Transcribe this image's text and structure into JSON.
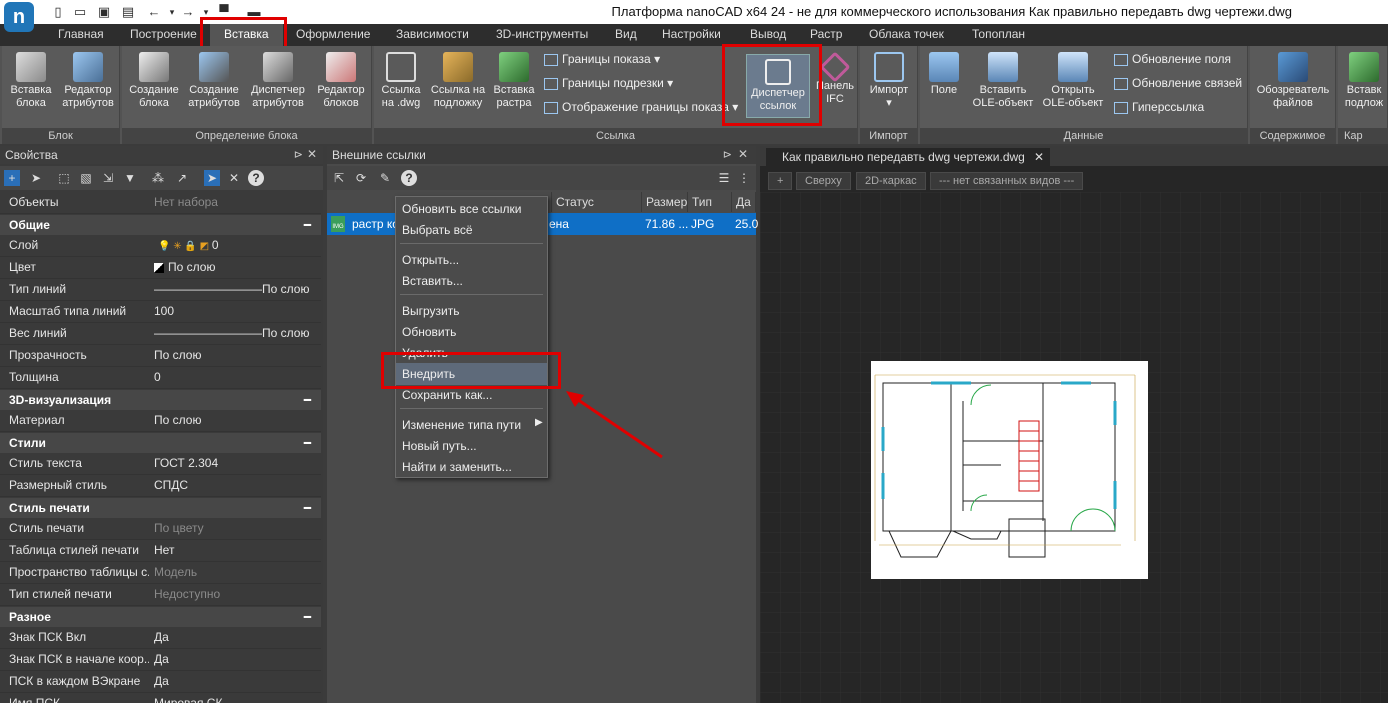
{
  "window": {
    "title": "Платформа nanoCAD x64 24 - не для коммерческого использования Как правильно передавть dwg чертежи.dwg",
    "logo_letter": "n"
  },
  "menu": [
    "Главная",
    "Построение",
    "Вставка",
    "Оформление",
    "Зависимости",
    "3D-инструменты",
    "Вид",
    "Настройки",
    "Вывод",
    "Растр",
    "Облака точек",
    "Топоплан"
  ],
  "ribbon": {
    "block_panel": {
      "label": "Блок",
      "buttons": [
        "Вставка блока",
        "Редактор атрибутов"
      ]
    },
    "block_def_panel": {
      "label": "Определение блока",
      "buttons": [
        "Создание блока",
        "Создание атрибутов",
        "Диспетчер атрибутов",
        "Редактор блоков"
      ]
    },
    "links_panel": {
      "label": "Ссылка",
      "buttons": [
        "Ссылка на .dwg",
        "Ссылка на подложку",
        "Вставка растра"
      ],
      "small": [
        "Границы показа",
        "Границы подрезки",
        "Отображение границы показа"
      ],
      "highlighted": "Диспетчер ссылок",
      "ifc": "Панель IFC"
    },
    "import_panel": {
      "label": "Импорт",
      "button": "Импорт"
    },
    "data_panel": {
      "label": "Данные",
      "buttons": [
        "Поле",
        "Вставить OLE-объект",
        "Открыть OLE-объект"
      ],
      "small": [
        "Обновление поля",
        "Обновление связей",
        "Гиперссылка"
      ]
    },
    "content_panel": {
      "label": "Содержимое",
      "button": "Обозреватель файлов"
    },
    "cut_panel": {
      "label": "Кар",
      "button": "Вставк подлож"
    }
  },
  "properties": {
    "title": "Свойства",
    "objects_label": "Объекты",
    "objects_value": "Нет набора",
    "rows": [
      {
        "type": "section",
        "label": "Общие"
      },
      {
        "type": "row",
        "name": "Слой",
        "value": "0"
      },
      {
        "type": "row",
        "name": "Цвет",
        "value": "По слою"
      },
      {
        "type": "row",
        "name": "Тип линий",
        "value": "—————————По слою"
      },
      {
        "type": "row",
        "name": "Масштаб типа линий",
        "value": "100"
      },
      {
        "type": "row",
        "name": "Вес линий",
        "value": "—————————По слою"
      },
      {
        "type": "row",
        "name": "Прозрачность",
        "value": "По слою"
      },
      {
        "type": "row",
        "name": "Толщина",
        "value": "0"
      },
      {
        "type": "section",
        "label": "3D-визуализация"
      },
      {
        "type": "row",
        "name": "Материал",
        "value": "По слою"
      },
      {
        "type": "section",
        "label": "Стили"
      },
      {
        "type": "row",
        "name": "Стиль текста",
        "value": "ГОСТ 2.304"
      },
      {
        "type": "row",
        "name": "Размерный стиль",
        "value": "СПДС"
      },
      {
        "type": "section",
        "label": "Стиль печати"
      },
      {
        "type": "row",
        "name": "Стиль печати",
        "value": "По цвету",
        "dim": true
      },
      {
        "type": "row",
        "name": "Таблица стилей печати",
        "value": "Нет"
      },
      {
        "type": "row",
        "name": "Пространство таблицы с...",
        "value": "Модель",
        "dim": true
      },
      {
        "type": "row",
        "name": "Тип стилей печати",
        "value": "Недоступно",
        "dim": true
      },
      {
        "type": "section",
        "label": "Разное"
      },
      {
        "type": "row",
        "name": "Знак ПСК Вкл",
        "value": "Да"
      },
      {
        "type": "row",
        "name": "Знак ПСК в начале коор...",
        "value": "Да"
      },
      {
        "type": "row",
        "name": "ПСК в каждом ВЭкране",
        "value": "Да"
      },
      {
        "type": "row",
        "name": "Имя ПСК",
        "value": "Мировая СК"
      }
    ]
  },
  "xref": {
    "title": "Внешние ссылки",
    "columns": [
      "Статус",
      "Размер",
      "Тип",
      "Да"
    ],
    "row": {
      "name": "растр ко",
      "status": "ена",
      "size": "71.86 ...",
      "type": "JPG",
      "date": "25.0",
      "icon_label": "IMG"
    }
  },
  "context_menu": {
    "group1": [
      "Обновить все ссылки",
      "Выбрать всё"
    ],
    "group2": [
      "Открыть...",
      "Вставить..."
    ],
    "group3": [
      "Выгрузить",
      "Обновить",
      "Удалить",
      "Внедрить",
      "Сохранить как..."
    ],
    "group4": [
      "Изменение типа пути",
      "Новый путь...",
      "Найти и заменить..."
    ],
    "highlighted": "Внедрить"
  },
  "document": {
    "tab": "Как правильно передавть dwg чертежи.dwg",
    "view_buttons": [
      "+",
      "Сверху",
      "2D-каркас",
      "--- нет связанных видов ---"
    ]
  },
  "colors": {
    "accent": "#0f6fc6",
    "highlight": "#e00000",
    "ribbon": "#5a5a5a"
  }
}
